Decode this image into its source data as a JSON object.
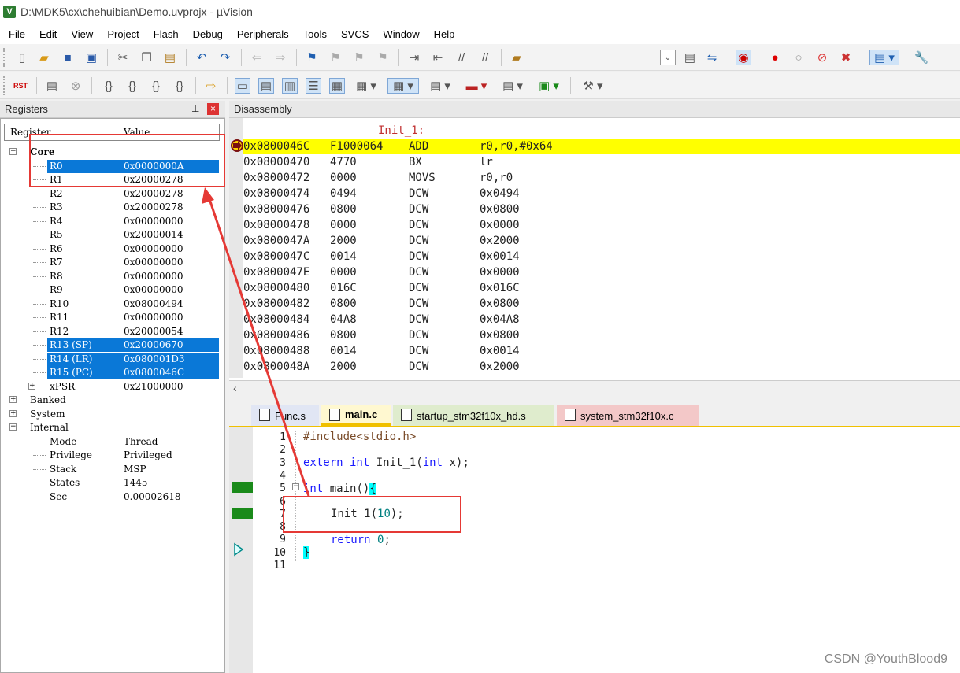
{
  "window": {
    "title": "D:\\MDK5\\cx\\chehuibian\\Demo.uvprojx - µVision",
    "app_icon": "V"
  },
  "menu": [
    "File",
    "Edit",
    "View",
    "Project",
    "Flash",
    "Debug",
    "Peripherals",
    "Tools",
    "SVCS",
    "Window",
    "Help"
  ],
  "toolbar2": {
    "reset_label": "RST"
  },
  "registers": {
    "title": "Registers",
    "pin": "⊥",
    "close": "×",
    "col_register": "Register",
    "col_value": "Value",
    "core_label": "Core",
    "rows": [
      {
        "name": "R0",
        "value": "0x0000000A"
      },
      {
        "name": "R1",
        "value": "0x20000278"
      },
      {
        "name": "R2",
        "value": "0x20000278"
      },
      {
        "name": "R3",
        "value": "0x20000278"
      },
      {
        "name": "R4",
        "value": "0x00000000"
      },
      {
        "name": "R5",
        "value": "0x20000014"
      },
      {
        "name": "R6",
        "value": "0x00000000"
      },
      {
        "name": "R7",
        "value": "0x00000000"
      },
      {
        "name": "R8",
        "value": "0x00000000"
      },
      {
        "name": "R9",
        "value": "0x00000000"
      },
      {
        "name": "R10",
        "value": "0x08000494"
      },
      {
        "name": "R11",
        "value": "0x00000000"
      },
      {
        "name": "R12",
        "value": "0x20000054"
      },
      {
        "name": "R13 (SP)",
        "value": "0x20000670"
      },
      {
        "name": "R14 (LR)",
        "value": "0x080001D3"
      },
      {
        "name": "R15 (PC)",
        "value": "0x0800046C"
      },
      {
        "name": "xPSR",
        "value": "0x21000000"
      }
    ],
    "groups": [
      "Banked",
      "System",
      "Internal"
    ],
    "internal": [
      {
        "name": "Mode",
        "value": "Thread"
      },
      {
        "name": "Privilege",
        "value": "Privileged"
      },
      {
        "name": "Stack",
        "value": "MSP"
      },
      {
        "name": "States",
        "value": "1445"
      },
      {
        "name": "Sec",
        "value": "0.00002618"
      }
    ]
  },
  "disassembly": {
    "title": "Disassembly",
    "label": "Init_1:",
    "rows": [
      {
        "addr": "0x0800046C",
        "code": "F1000064",
        "op": "ADD",
        "args": "r0,r0,#0x64"
      },
      {
        "addr": "0x08000470",
        "code": "4770",
        "op": "BX",
        "args": "lr"
      },
      {
        "addr": "0x08000472",
        "code": "0000",
        "op": "MOVS",
        "args": "r0,r0"
      },
      {
        "addr": "0x08000474",
        "code": "0494",
        "op": "DCW",
        "args": "0x0494"
      },
      {
        "addr": "0x08000476",
        "code": "0800",
        "op": "DCW",
        "args": "0x0800"
      },
      {
        "addr": "0x08000478",
        "code": "0000",
        "op": "DCW",
        "args": "0x0000"
      },
      {
        "addr": "0x0800047A",
        "code": "2000",
        "op": "DCW",
        "args": "0x2000"
      },
      {
        "addr": "0x0800047C",
        "code": "0014",
        "op": "DCW",
        "args": "0x0014"
      },
      {
        "addr": "0x0800047E",
        "code": "0000",
        "op": "DCW",
        "args": "0x0000"
      },
      {
        "addr": "0x08000480",
        "code": "016C",
        "op": "DCW",
        "args": "0x016C"
      },
      {
        "addr": "0x08000482",
        "code": "0800",
        "op": "DCW",
        "args": "0x0800"
      },
      {
        "addr": "0x08000484",
        "code": "04A8",
        "op": "DCW",
        "args": "0x04A8"
      },
      {
        "addr": "0x08000486",
        "code": "0800",
        "op": "DCW",
        "args": "0x0800"
      },
      {
        "addr": "0x08000488",
        "code": "0014",
        "op": "DCW",
        "args": "0x0014"
      },
      {
        "addr": "0x0800048A",
        "code": "2000",
        "op": "DCW",
        "args": "0x2000"
      }
    ]
  },
  "tabs": [
    "Func.s",
    "main.c",
    "startup_stm32f10x_hd.s",
    "system_stm32f10x.c"
  ],
  "editor": {
    "line_numbers": [
      "1",
      "2",
      "3",
      "4",
      "5",
      "6",
      "7",
      "8",
      "9",
      "10",
      "11"
    ],
    "l1": "#include<stdio.h>",
    "l3_kw": "extern int",
    "l3_name": " Init_1(",
    "l3_int": "int",
    "l3_rest": " x);",
    "l5_kw": "int",
    "l5_rest": " main()",
    "l5_brace": "{",
    "l7_call": "Init_1(",
    "l7_num": "10",
    "l7_end": ");",
    "l9_kw": "return",
    "l9_num": " 0",
    "l9_end": ";",
    "l10_brace": "}"
  },
  "watermark": "CSDN @YouthBlood9",
  "colors": {
    "selection": "#0a78d7",
    "current_line": "#ffff00",
    "annotation": "#e53935",
    "breakpoint": "#1a8a1a"
  }
}
